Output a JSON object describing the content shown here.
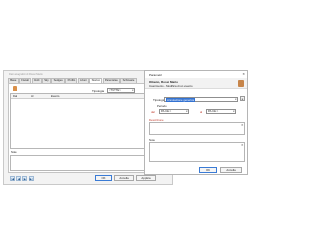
{
  "main_window": {
    "title": "Dati anagrafici di Rossi Mario",
    "tabs": [
      "Base",
      "Fiscali",
      "Civili",
      "Sky",
      "Sedges",
      "Profilo",
      "Liberi",
      "Storico",
      "Parentelas",
      "Schinaste"
    ],
    "active_tab": "Storico",
    "tipologia_label": "Tipologia",
    "tipologia_value": "<TUTTE>",
    "table_headers": [
      "Dal",
      "Al",
      "Evento"
    ],
    "note_label": "Note",
    "nav_buttons": [
      "|◀",
      "◀",
      "▶",
      "▶|"
    ],
    "ok_label": "OK",
    "annulla_label": "Annulla",
    "applica_label": "Applica"
  },
  "dialog": {
    "title": "Parametri",
    "name": "Ottavio, Rossi Mario",
    "subtitle": "Inserimento - Modifica di un evento",
    "tipologia_label": "Tipologia",
    "tipologia_value": "Annotazione generica",
    "periodo_label": "Periodo",
    "dal_label": "dal",
    "al_label": "al",
    "dal_value": "PA.CE.>",
    "al_value": "PA.CE.>",
    "descrizione_label": "Descrizione",
    "note_label": "Note",
    "ok_label": "OK",
    "annulla_label": "Annulla"
  }
}
